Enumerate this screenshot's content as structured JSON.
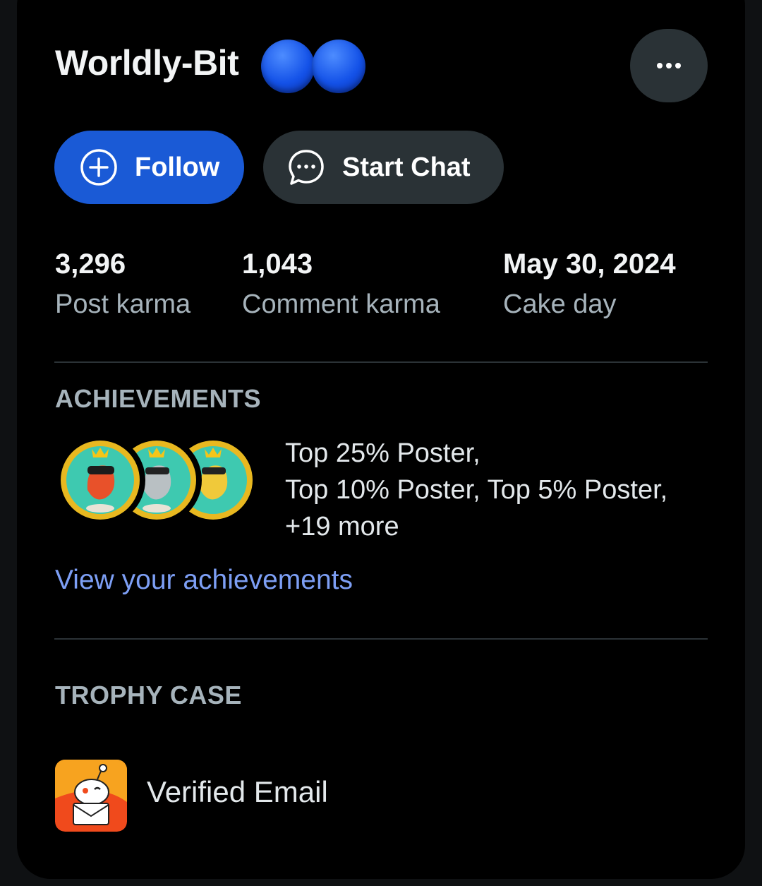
{
  "profile": {
    "username": "Worldly-Bit",
    "more_icon": "ellipsis-icon",
    "follow_label": "Follow",
    "follow_icon": "plus-circle-icon",
    "chat_label": "Start Chat",
    "chat_icon": "chat-bubble-icon"
  },
  "stats": [
    {
      "value": "3,296",
      "label": "Post karma"
    },
    {
      "value": "1,043",
      "label": "Comment karma"
    },
    {
      "value": "May 30, 2024",
      "label": "Cake day"
    }
  ],
  "achievements": {
    "title": "ACHIEVEMENTS",
    "lines": [
      "Top 25% Poster,",
      "Top 10% Poster, Top 5% Poster,",
      "+19 more"
    ],
    "link": "View your achievements",
    "badge_icons": [
      "top-25-poster-badge-icon",
      "top-10-poster-badge-icon",
      "top-5-poster-badge-icon"
    ]
  },
  "trophy_case": {
    "title": "TROPHY CASE",
    "items": [
      {
        "label": "Verified Email",
        "icon": "verified-email-trophy-icon"
      }
    ]
  },
  "colors": {
    "follow": "#1a5ad6",
    "secondary_button": "#2a3236",
    "link": "#7d9ff5",
    "muted_text": "#a6b3bb",
    "redaction_blue": "#1452e8"
  }
}
